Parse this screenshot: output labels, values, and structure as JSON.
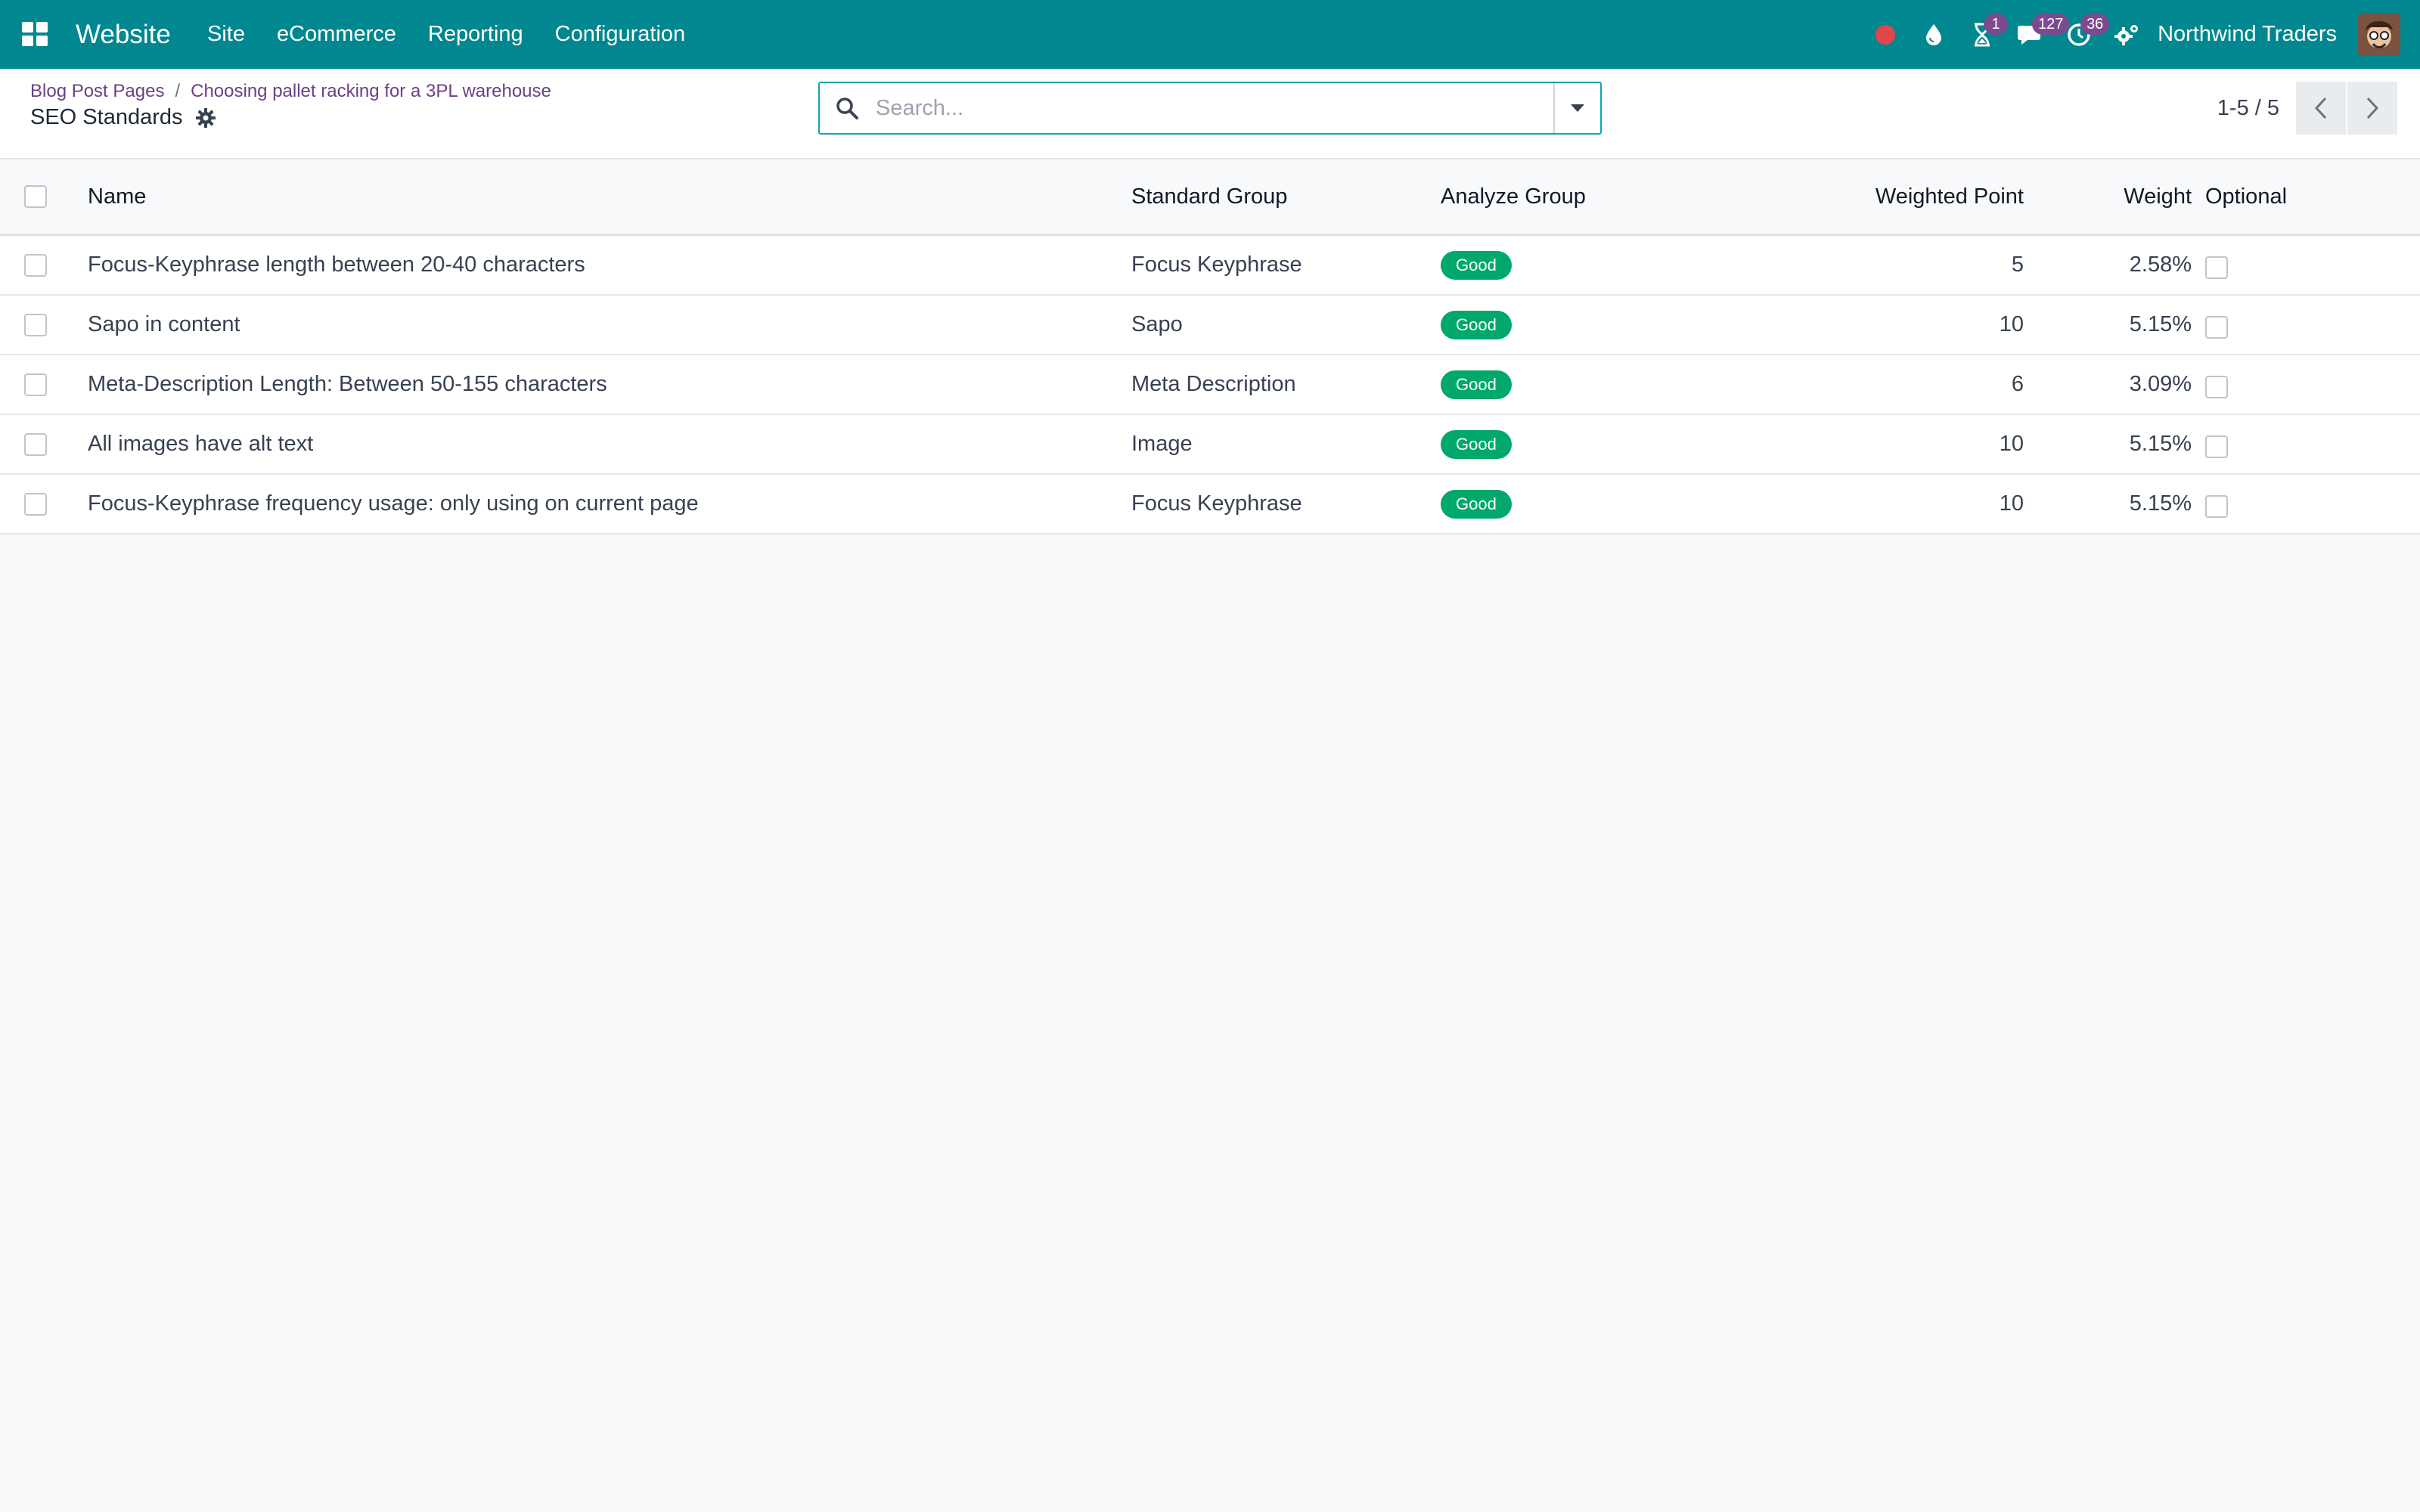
{
  "navbar": {
    "brand": "Website",
    "menu": [
      "Site",
      "eCommerce",
      "Reporting",
      "Configuration"
    ],
    "badges": {
      "activities": "1",
      "messages": "127",
      "clock": "36"
    },
    "company": "Northwind Traders",
    "colors": {
      "bar": "#018790",
      "badge": "#7b4a8f",
      "record": "#e2464b"
    }
  },
  "breadcrumb": {
    "parent": "Blog Post Pages",
    "separator": "/",
    "current_record": "Choosing pallet racking for a 3PL warehouse"
  },
  "page": {
    "title": "SEO Standards"
  },
  "search": {
    "placeholder": "Search..."
  },
  "pager": {
    "value": "1-5 / 5"
  },
  "table": {
    "columns": {
      "name": "Name",
      "standard_group": "Standard Group",
      "analyze_group": "Analyze Group",
      "weighted_point": "Weighted Point",
      "weight": "Weight",
      "optional": "Optional"
    },
    "rows": [
      {
        "name": "Focus-Keyphrase length between 20-40 characters",
        "standard_group": "Focus Keyphrase",
        "analyze_group": "Good",
        "weighted_point": "5",
        "weight": "2.58%",
        "optional": false
      },
      {
        "name": "Sapo in content",
        "standard_group": "Sapo",
        "analyze_group": "Good",
        "weighted_point": "10",
        "weight": "5.15%",
        "optional": false
      },
      {
        "name": "Meta-Description Length: Between 50-155 characters",
        "standard_group": "Meta Description",
        "analyze_group": "Good",
        "weighted_point": "6",
        "weight": "3.09%",
        "optional": false
      },
      {
        "name": "All images have alt text",
        "standard_group": "Image",
        "analyze_group": "Good",
        "weighted_point": "10",
        "weight": "5.15%",
        "optional": false
      },
      {
        "name": "Focus-Keyphrase frequency usage: only using on current page",
        "standard_group": "Focus Keyphrase",
        "analyze_group": "Good",
        "weighted_point": "10",
        "weight": "5.15%",
        "optional": false
      }
    ],
    "colors": {
      "good_pill": "#00a86b"
    }
  }
}
